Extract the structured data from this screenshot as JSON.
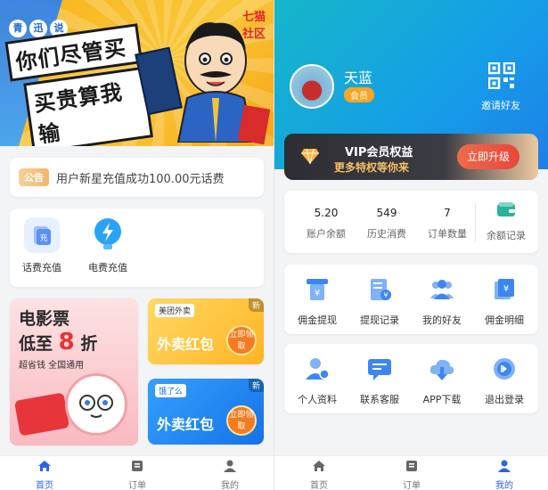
{
  "watermark": "七猫社区",
  "left": {
    "banner": {
      "brand_chars": [
        "青",
        "迅",
        "说"
      ],
      "slogan_line1": "你们尽管买",
      "slogan_line2": "买贵算我输"
    },
    "notice": {
      "tag": "公告",
      "text": "用户新星充值成功100.00元话费"
    },
    "recharge": [
      {
        "label": "话费充值",
        "icon": "phone-bill-icon",
        "color": "#5b8ff9"
      },
      {
        "label": "电费充值",
        "icon": "lightning-icon",
        "color": "#2ba3f5"
      }
    ],
    "movie_promo": {
      "line1": "电影票",
      "line2_prefix": "低至",
      "line2_num": "8",
      "line2_suffix": "折",
      "line3": "超省钱 全国通用"
    },
    "meituan_promo": {
      "brand": "美团外卖",
      "title": "外卖红包",
      "cta": "立即领取",
      "badge": "新"
    },
    "eleme_promo": {
      "brand": "饿了么",
      "title": "外卖红包",
      "cta": "立即领取",
      "badge": "新"
    },
    "tabs": [
      {
        "label": "首页",
        "icon": "home-icon",
        "active": true
      },
      {
        "label": "订单",
        "icon": "order-icon",
        "active": false
      },
      {
        "label": "我的",
        "icon": "user-icon",
        "active": false
      }
    ]
  },
  "right": {
    "user": {
      "name": "天蓝",
      "badge": "会员"
    },
    "invite": {
      "label": "邀请好友",
      "icon": "qr-code-icon"
    },
    "vip": {
      "title": "VIP会员权益",
      "subtitle": "更多特权等你来",
      "button": "立即升级",
      "icon": "diamond-icon"
    },
    "stats": [
      {
        "value": "5.20",
        "label": "账户余额"
      },
      {
        "value": "549",
        "label": "历史消费"
      },
      {
        "value": "7",
        "label": "订单数量"
      }
    ],
    "balance_record": {
      "label": "余额记录",
      "icon": "wallet-icon"
    },
    "grid1": [
      {
        "label": "佣金提现",
        "icon": "withdraw-icon"
      },
      {
        "label": "提现记录",
        "icon": "record-icon"
      },
      {
        "label": "我的好友",
        "icon": "friends-icon"
      },
      {
        "label": "佣金明细",
        "icon": "commission-detail-icon"
      }
    ],
    "grid2": [
      {
        "label": "个人资料",
        "icon": "profile-icon"
      },
      {
        "label": "联系客服",
        "icon": "chat-icon"
      },
      {
        "label": "APP下载",
        "icon": "cloud-download-icon"
      },
      {
        "label": "退出登录",
        "icon": "logout-icon"
      }
    ],
    "tabs": [
      {
        "label": "首页",
        "icon": "home-icon",
        "active": false
      },
      {
        "label": "订单",
        "icon": "order-icon",
        "active": false
      },
      {
        "label": "我的",
        "icon": "user-icon",
        "active": true
      }
    ]
  },
  "colors": {
    "accent": "#2a63e8",
    "header": "#159ee8",
    "vip_gold": "#f4c064",
    "cta": "#e8463b"
  }
}
